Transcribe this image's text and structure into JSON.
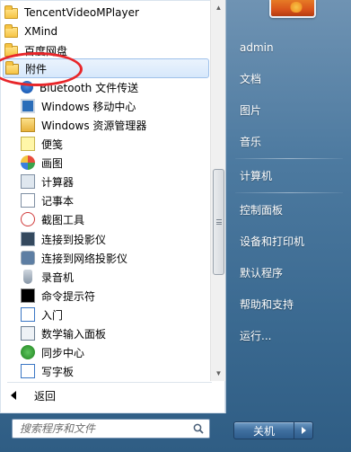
{
  "programs": {
    "items": [
      {
        "label": "TencentVideoMPlayer",
        "icon": "folder-icon",
        "level": 0
      },
      {
        "label": "XMind",
        "icon": "folder-icon",
        "level": 0
      },
      {
        "label": "百度网盘",
        "icon": "folder-icon",
        "level": 0
      },
      {
        "label": "附件",
        "icon": "folder-open-icon",
        "level": 0,
        "selected": true
      },
      {
        "label": "Bluetooth 文件传送",
        "icon": "bluetooth-icon",
        "level": 1
      },
      {
        "label": "Windows 移动中心",
        "icon": "mobility-center-icon",
        "level": 1
      },
      {
        "label": "Windows 资源管理器",
        "icon": "explorer-icon",
        "level": 1
      },
      {
        "label": "便笺",
        "icon": "sticky-notes-icon",
        "level": 1
      },
      {
        "label": "画图",
        "icon": "paint-icon",
        "level": 1
      },
      {
        "label": "计算器",
        "icon": "calculator-icon",
        "level": 1
      },
      {
        "label": "记事本",
        "icon": "notepad-icon",
        "level": 1
      },
      {
        "label": "截图工具",
        "icon": "snipping-tool-icon",
        "level": 1
      },
      {
        "label": "连接到投影仪",
        "icon": "projector-icon",
        "level": 1
      },
      {
        "label": "连接到网络投影仪",
        "icon": "network-projector-icon",
        "level": 1
      },
      {
        "label": "录音机",
        "icon": "microphone-icon",
        "level": 1
      },
      {
        "label": "命令提示符",
        "icon": "command-prompt-icon",
        "level": 1
      },
      {
        "label": "入门",
        "icon": "getting-started-icon",
        "level": 1
      },
      {
        "label": "数学输入面板",
        "icon": "math-input-icon",
        "level": 1
      },
      {
        "label": "同步中心",
        "icon": "sync-center-icon",
        "level": 1
      },
      {
        "label": "写字板",
        "icon": "wordpad-icon",
        "level": 1
      }
    ],
    "back_label": "返回"
  },
  "search": {
    "placeholder": "搜索程序和文件"
  },
  "right_pane": {
    "items": [
      {
        "label": "admin",
        "group": 1
      },
      {
        "label": "文档",
        "group": 1
      },
      {
        "label": "图片",
        "group": 1
      },
      {
        "label": "音乐",
        "group": 1
      },
      {
        "label": "计算机",
        "group": 2
      },
      {
        "label": "控制面板",
        "group": 3
      },
      {
        "label": "设备和打印机",
        "group": 3
      },
      {
        "label": "默认程序",
        "group": 3
      },
      {
        "label": "帮助和支持",
        "group": 3
      },
      {
        "label": "运行...",
        "group": 3
      }
    ]
  },
  "shutdown": {
    "label": "关机"
  },
  "colors": {
    "selection_border": "#9fc1ea",
    "annotation": "#e8262a",
    "right_pane_bg": "#4d7aa0"
  }
}
